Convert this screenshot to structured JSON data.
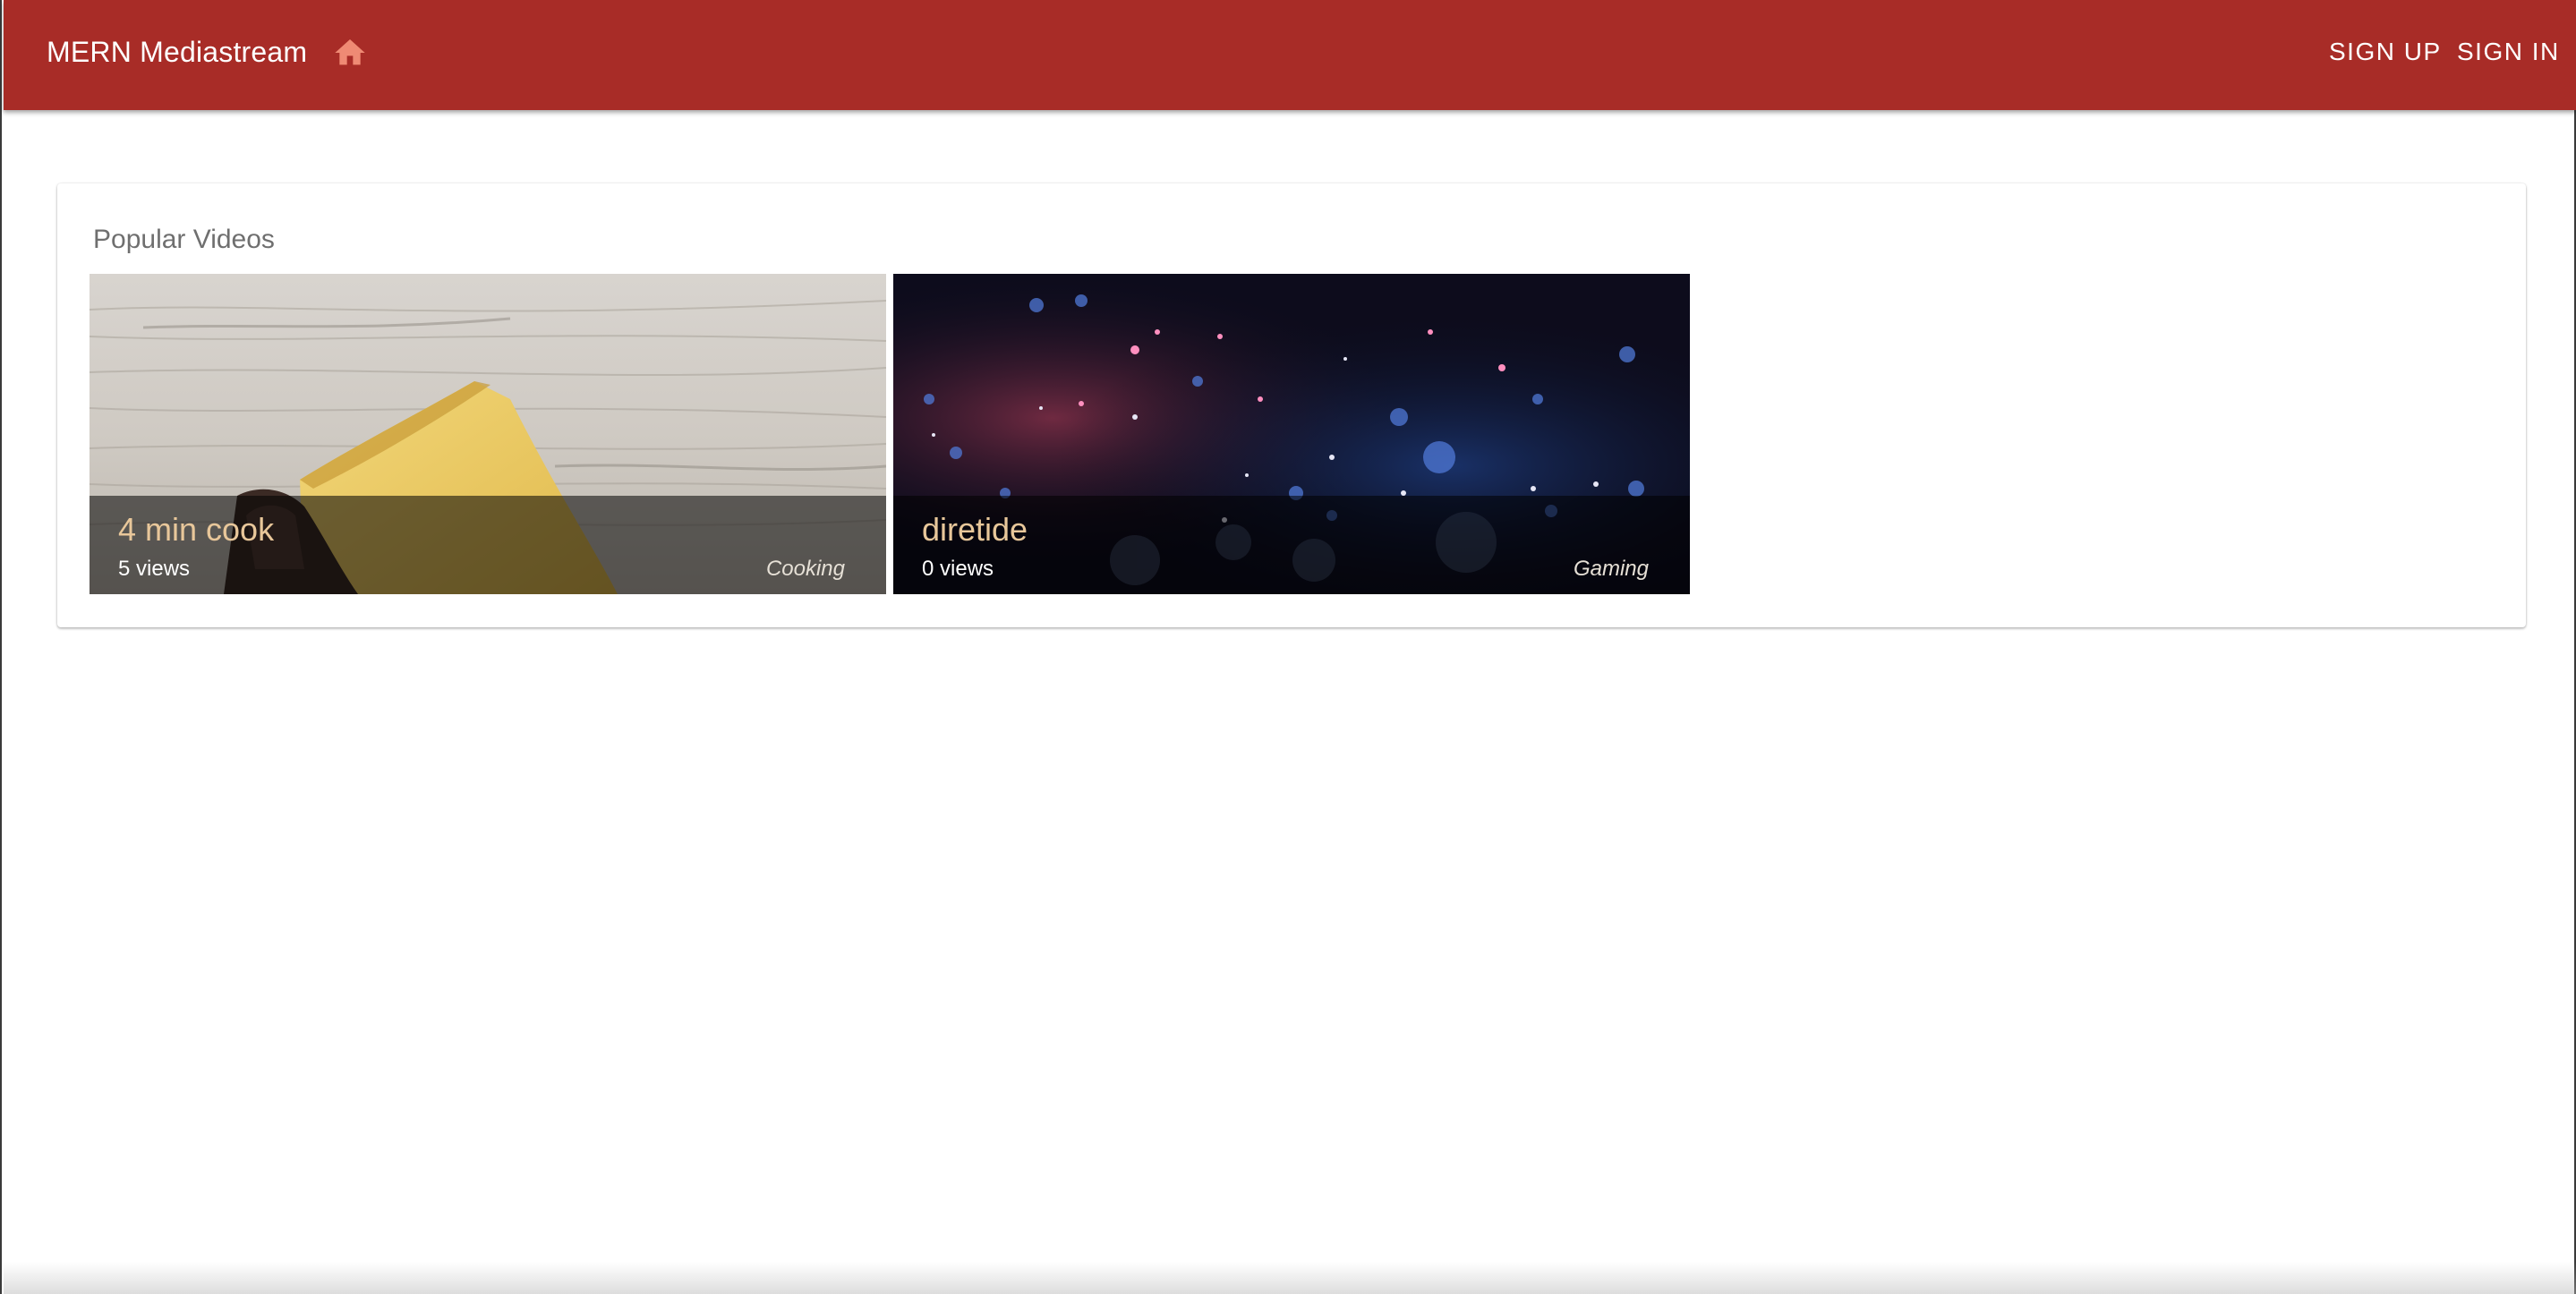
{
  "appbar": {
    "title": "MERN Mediastream",
    "home_icon": "home-icon",
    "color": "#a82c27",
    "signup_label": "SIGN UP",
    "signin_label": "SIGN IN"
  },
  "popular": {
    "heading": "Popular Videos",
    "videos": [
      {
        "title": "4 min cook",
        "views": "5 views",
        "genre": "Cooking",
        "thumbnail": "bread-slice-on-wood"
      },
      {
        "title": "diretide",
        "views": "0 views",
        "genre": "Gaming",
        "thumbnail": "bokeh-particles-night"
      }
    ]
  },
  "colors": {
    "title_text": "#e8c79a",
    "overlay": "rgba(0,0,0,0.55)"
  }
}
